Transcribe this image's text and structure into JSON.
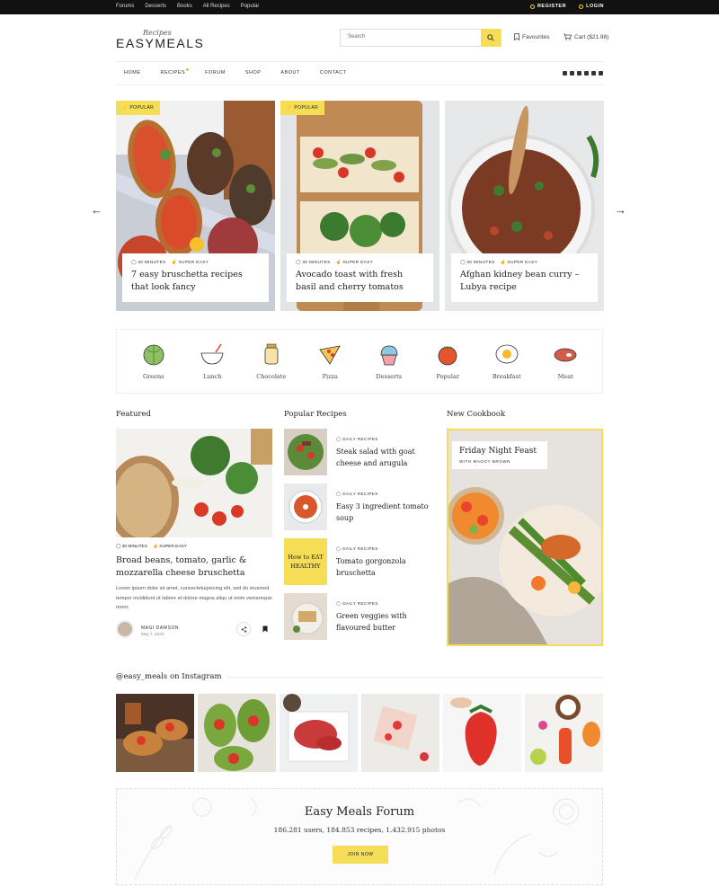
{
  "topbar": {
    "links": [
      "Forums",
      "Desserts",
      "Books",
      "All Recipes",
      "Popular"
    ],
    "register": "REGISTER",
    "login": "LOGIN"
  },
  "header": {
    "logo_script": "Recipes",
    "logo_word": "EASYMEALS",
    "search_placeholder": "Search",
    "favourites": "Favourites",
    "cart": "Cart ($21.98)"
  },
  "nav": {
    "items": [
      "HOME",
      "RECIPES",
      "FORUM",
      "SHOP",
      "ABOUT",
      "CONTACT"
    ]
  },
  "hero": [
    {
      "tag": "POPULAR",
      "time": "30 MINUTES",
      "level": "SUPER EASY",
      "title": "7 easy bruschetta recipes that look fancy"
    },
    {
      "tag": "POPULAR",
      "time": "30 MINUTES",
      "level": "SUPER EASY",
      "title": "Avocado toast with fresh basil and cherry tomatos"
    },
    {
      "tag": "",
      "time": "30 MINUTES",
      "level": "SUPER EASY",
      "title": "Afghan kidney bean curry – Lubya recipe"
    }
  ],
  "categories": [
    "Greens",
    "Lunch",
    "Chocolate",
    "Pizza",
    "Desserts",
    "Popular",
    "Breakfast",
    "Meat"
  ],
  "featured": {
    "heading": "Featured",
    "time": "30 MINUTES",
    "level": "SUPER EASY",
    "title": "Broad beans, tomato, garlic & mozzarella cheese bruschetta",
    "body": "Lorem ipsum dolor sit amet, consectetuipiscing elit, sed do eiusmod tempor incididunt ut labore et dolore magna aliqu ut enim veniamquis noerc",
    "author": "MAGI DAWSON",
    "date": "May 7, 2020"
  },
  "popular": {
    "heading": "Popular Recipes",
    "items": [
      {
        "meta": "DAILY RECIPES",
        "title": "Steak salad with goat cheese and arugula"
      },
      {
        "meta": "DAILY RECIPES",
        "title": "Easy 3 ingredient tomato soup"
      },
      {
        "meta": "DAILY RECIPES",
        "title": "Tomato gorgonzola bruschetta"
      },
      {
        "meta": "DAILY RECIPES",
        "title": "Green veggies with flavoured butter"
      }
    ],
    "thumb3_text": "How to EAT HEALTHY"
  },
  "cookbook": {
    "heading": "New Cookbook",
    "title": "Friday Night Feast",
    "subtitle": "WITH MAGGY BROWN"
  },
  "instagram": {
    "heading": "@easy_meals on Instagram"
  },
  "forum": {
    "title": "Easy Meals Forum",
    "stats": "186.281 users, 184.853 recipes, 1.432.915 photos",
    "button": "JOIN NOW"
  },
  "colors": {
    "accent": "#f5dd55",
    "topbar": "#111111"
  }
}
